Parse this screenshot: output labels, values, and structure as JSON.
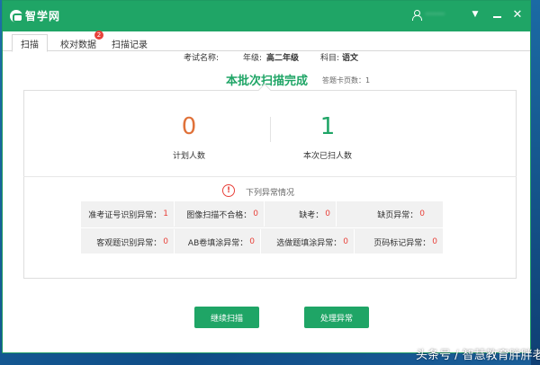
{
  "app": {
    "title": "智学网",
    "user": "··········"
  },
  "window_controls": {
    "dropdown": "▼",
    "close": "✕"
  },
  "tabs": [
    {
      "label": "扫描",
      "active": true
    },
    {
      "label": "校对数据",
      "badge": "2"
    },
    {
      "label": "扫描记录"
    }
  ],
  "exam": {
    "name_label": "考试名称:",
    "grade_label": "年级:",
    "grade_value": "高二年级",
    "subject_label": "科目:",
    "subject_value": "语文"
  },
  "status": {
    "title": "本批次扫描完成",
    "answer_cards": "答题卡页数：1"
  },
  "summary": {
    "planned": {
      "value": "0",
      "label": "计划人数"
    },
    "scanned": {
      "value": "1",
      "label": "本次已扫人数"
    }
  },
  "anomalies": {
    "title": "下列异常情况",
    "warn_glyph": "!",
    "items": [
      {
        "label": "准考证号识别异常：",
        "value": "1"
      },
      {
        "label": "图像扫描不合格：",
        "value": "0"
      },
      {
        "label": "缺考：",
        "value": "0"
      },
      {
        "label": "缺页异常：",
        "value": "0"
      },
      {
        "label": "客观题识别异常：",
        "value": "0"
      },
      {
        "label": "AB卷填涂异常：",
        "value": "0"
      },
      {
        "label": "选做题填涂异常：",
        "value": "0"
      },
      {
        "label": "页码标记异常：",
        "value": "0"
      }
    ]
  },
  "buttons": {
    "continue": "继续扫描",
    "handle": "处理异常"
  },
  "watermark": "头条号 / 智慧教育胖胖老师",
  "colors": {
    "brand_green": "#1fa566",
    "orange": "#e0723a",
    "alert_red": "#e8413a"
  }
}
